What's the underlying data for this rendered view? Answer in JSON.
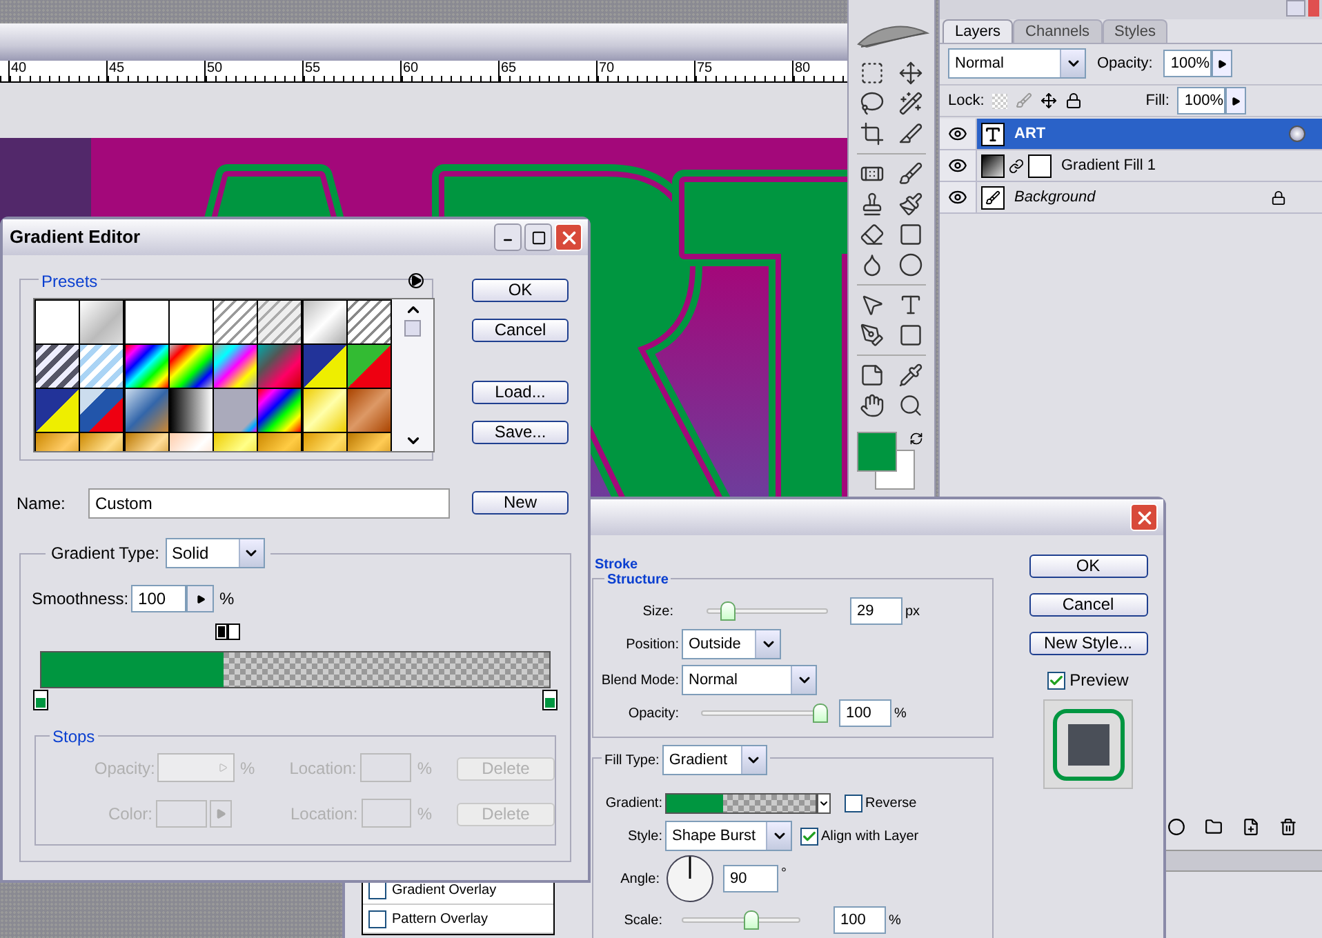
{
  "ruler": {
    "ticks": [
      "40",
      "45",
      "50",
      "55",
      "60",
      "65",
      "70",
      "75",
      "80"
    ]
  },
  "layers_panel": {
    "tabs": [
      {
        "label": "Layers",
        "selected": true
      },
      {
        "label": "Channels",
        "selected": false
      },
      {
        "label": "Styles",
        "selected": false
      }
    ],
    "blend_mode": "Normal",
    "opacity_label": "Opacity:",
    "opacity": "100%",
    "lock_label": "Lock:",
    "fill_label": "Fill:",
    "fill": "100%",
    "layers": [
      {
        "name": "ART",
        "kind": "text",
        "selected": true,
        "effects": true,
        "locked": false
      },
      {
        "name": "Gradient Fill 1",
        "kind": "fill",
        "selected": false,
        "effects": false,
        "locked": false
      },
      {
        "name": "Background",
        "kind": "background",
        "selected": false,
        "effects": false,
        "locked": true
      }
    ]
  },
  "gradient_editor": {
    "title": "Gradient Editor",
    "presets_label": "Presets",
    "buttons": [
      "OK",
      "Cancel",
      "Load...",
      "Save..."
    ],
    "name_label": "Name:",
    "name": "Custom",
    "new_button": "New",
    "gradient_type_label": "Gradient Type:",
    "gradient_type": "Solid",
    "smoothness_label": "Smoothness:",
    "smoothness": "100",
    "smoothness_unit": "%",
    "gradient": {
      "level": 0.36
    },
    "stops_label": "Stops",
    "stop_rows": [
      {
        "label": "Opacity:",
        "kind": "opacity",
        "unit": "%",
        "location_label": "Location:",
        "location_unit": "%",
        "delete": "Delete"
      },
      {
        "label": "Color:",
        "kind": "color",
        "location_label": "Location:",
        "location_unit": "%",
        "delete": "Delete"
      }
    ]
  },
  "layer_style": {
    "styles": [
      {
        "label": "Gradient Overlay",
        "checked": false
      },
      {
        "label": "Pattern Overlay",
        "checked": false
      }
    ],
    "section": "Stroke",
    "structure": "Structure",
    "size": {
      "label": "Size:",
      "value": "29",
      "unit": "px",
      "level": 0.17
    },
    "position": {
      "label": "Position:",
      "value": "Outside"
    },
    "blend_mode": {
      "label": "Blend Mode:",
      "value": "Normal"
    },
    "opacity": {
      "label": "Opacity:",
      "value": "100",
      "unit": "%",
      "level": 1
    },
    "fill_type": {
      "label": "Fill Type:",
      "value": "Gradient"
    },
    "gradient": {
      "label": "Gradient:",
      "level": 0.38
    },
    "reverse": {
      "label": "Reverse",
      "checked": false
    },
    "style": {
      "label": "Style:",
      "value": "Shape Burst"
    },
    "align": {
      "label": "Align with Layer",
      "checked": true
    },
    "angle": {
      "label": "Angle:",
      "value": "90",
      "unit": "°"
    },
    "scale": {
      "label": "Scale:",
      "value": "100",
      "unit": "%",
      "level": 0.6
    },
    "buttons": [
      "OK",
      "Cancel",
      "New Style..."
    ],
    "preview": {
      "label": "Preview",
      "checked": true
    }
  }
}
